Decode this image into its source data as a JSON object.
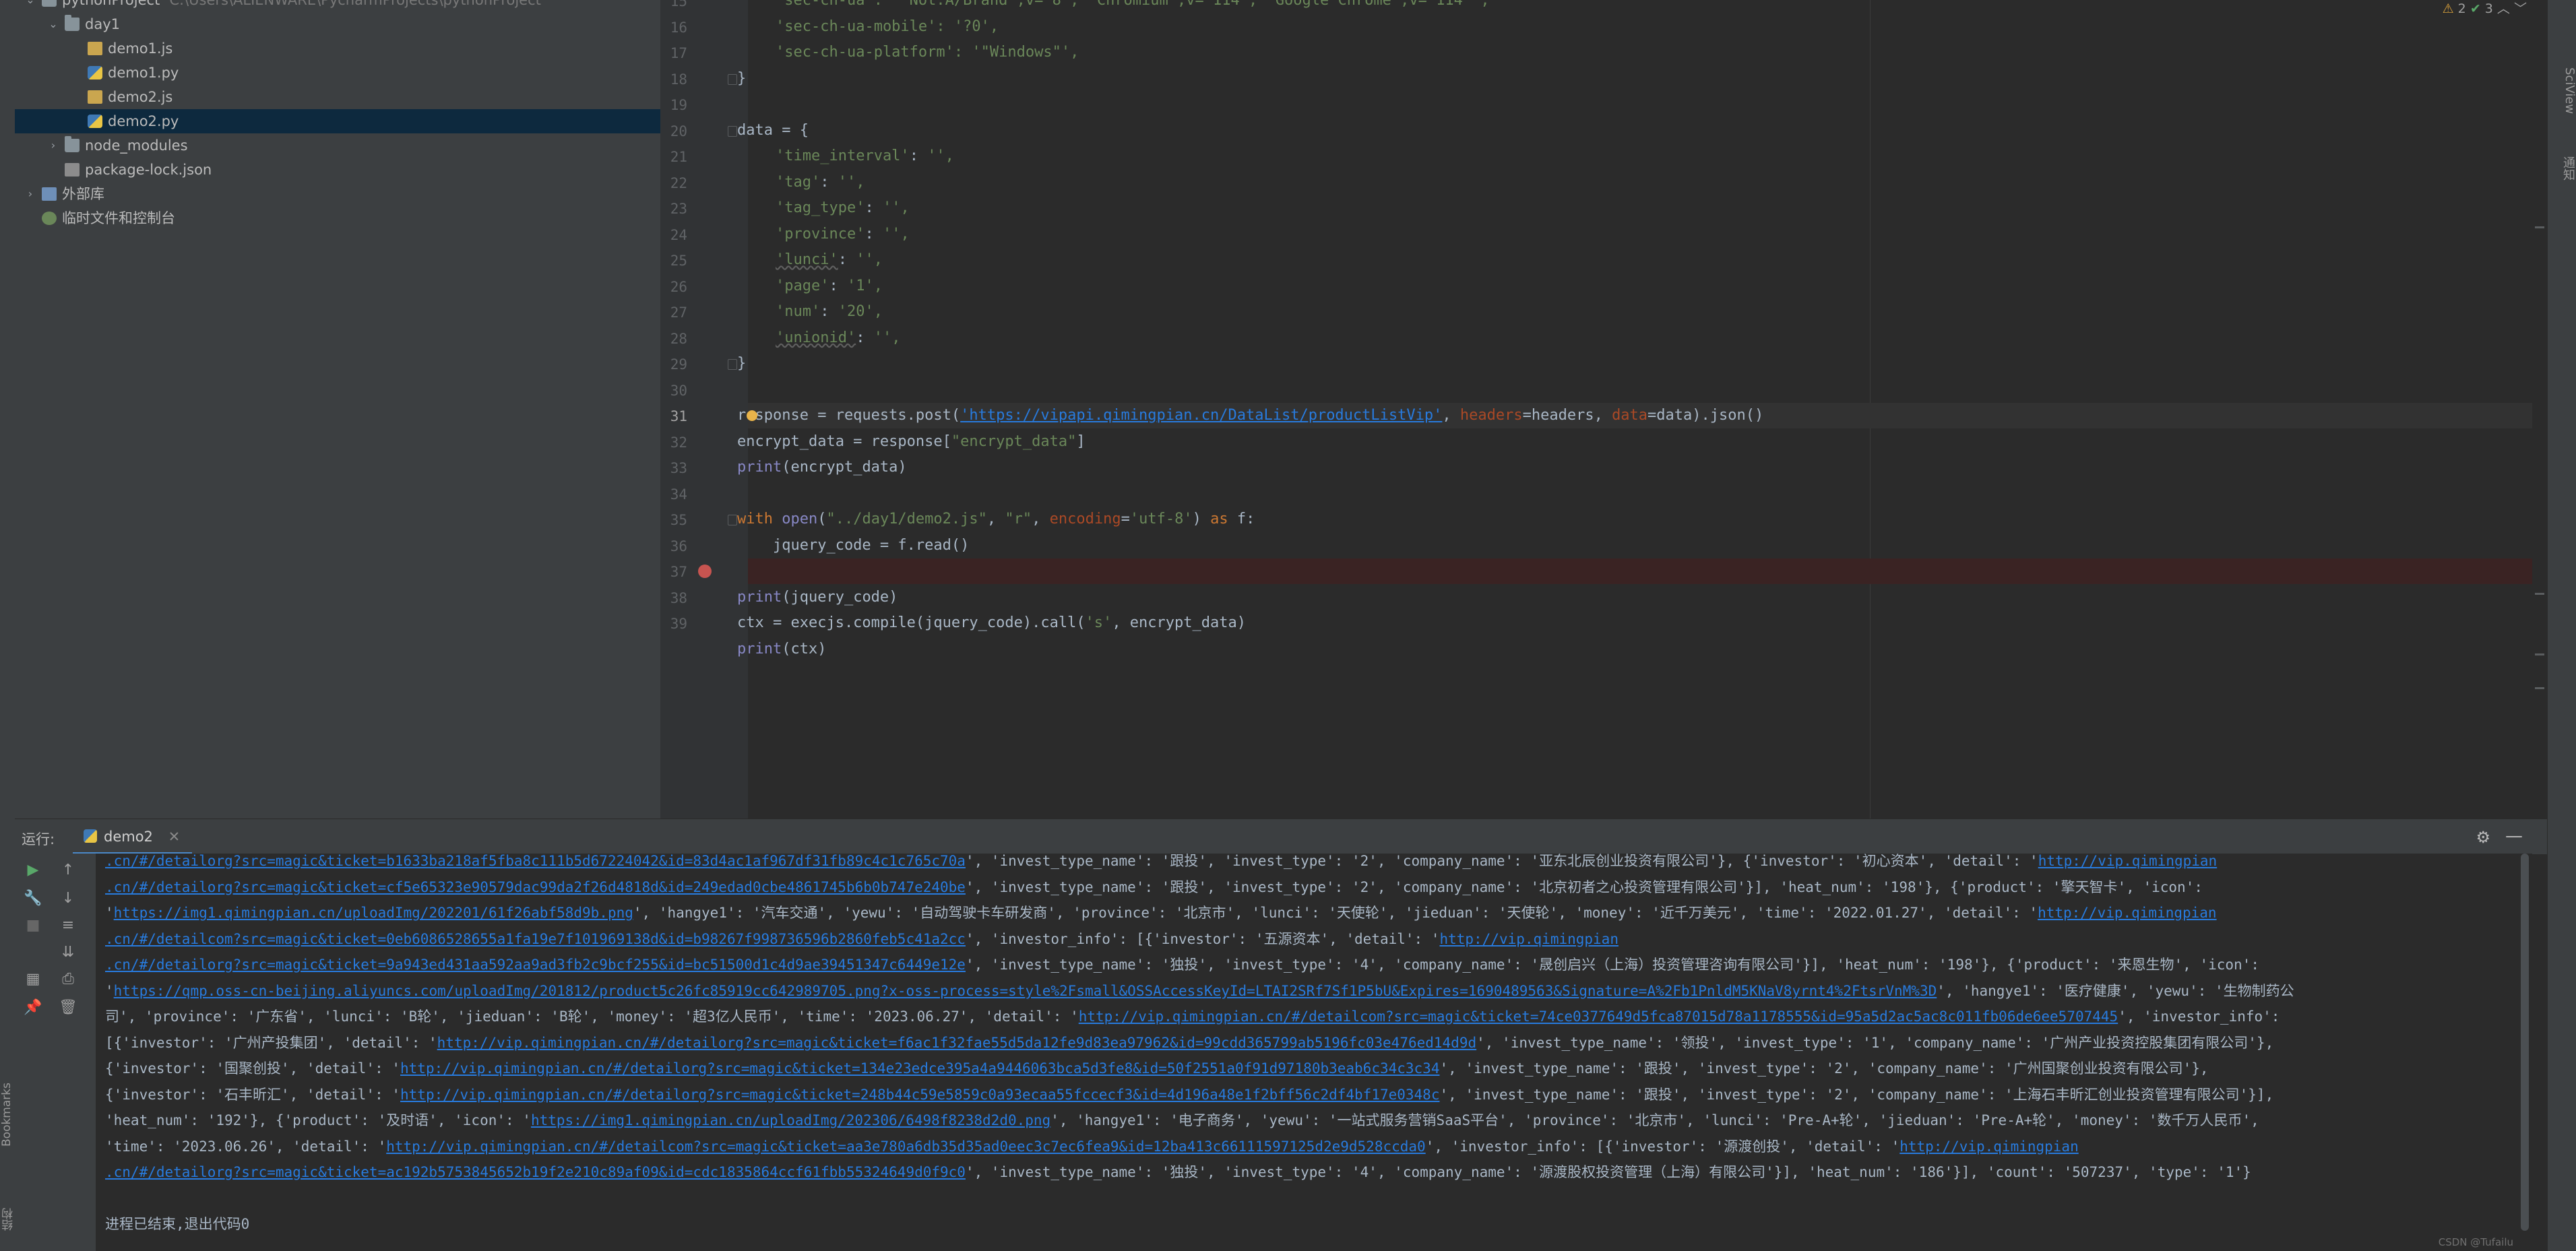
{
  "project_tree": [
    {
      "label": "pythonProject",
      "path": "C:\\Users\\ALIENWARE\\PycharmProjects\\pythonProject",
      "kind": "folder",
      "expanded": true
    },
    {
      "label": "day1",
      "kind": "folder",
      "expanded": true
    },
    {
      "label": "demo1.js",
      "kind": "js"
    },
    {
      "label": "demo1.py",
      "kind": "py"
    },
    {
      "label": "demo2.js",
      "kind": "js"
    },
    {
      "label": "demo2.py",
      "kind": "py",
      "selected": true
    },
    {
      "label": "node_modules",
      "kind": "folder",
      "expanded": false
    },
    {
      "label": "package-lock.json",
      "kind": "json"
    },
    {
      "label": "外部库",
      "kind": "lib",
      "expanded": false
    },
    {
      "label": "临时文件和控制台",
      "kind": "scratch"
    }
  ],
  "editor": {
    "inspection": {
      "warnings": "2",
      "checks": "3"
    },
    "current_line": 31,
    "breakpoint_line": 37,
    "line_numbers": [
      "15",
      "16",
      "17",
      "18",
      "19",
      "20",
      "21",
      "22",
      "23",
      "24",
      "25",
      "26",
      "27",
      "28",
      "29",
      "30",
      "31",
      "32",
      "33",
      "34",
      "35",
      "36",
      "37",
      "38",
      "39"
    ],
    "lines": {
      "l15": "'sec-ch-ua': '\"Not.A/Brand\";v=\"8\", \"Chromium\";v=\"114\", \"Google Chrome\";v=\"114\"',",
      "l16": "'sec-ch-ua-mobile': '?0',",
      "l17": "'sec-ch-ua-platform': '\"Windows\"',",
      "l18": "}",
      "l20": "data = {",
      "l21_key": "'time_interval'",
      "l21_val": "'',",
      "l22_key": "'tag'",
      "l22_val": "'',",
      "l23_key": "'tag_type'",
      "l23_val": "'',",
      "l24_key": "'province'",
      "l24_val": "'',",
      "l25_key": "'lunci'",
      "l25_val": "'',",
      "l26_key": "'page'",
      "l26_val": "'1',",
      "l27_key": "'num'",
      "l27_val": "'20',",
      "l28_key": "'unionid'",
      "l28_val": "'',",
      "l29": "}",
      "l31_a": "response = requests.post(",
      "l31_url": "'https://vipapi.qimingpian.cn/DataList/productListVip'",
      "l31_b": ", ",
      "l31_headers": "headers",
      "l31_c": "=headers, ",
      "l31_data": "data",
      "l31_d": "=data).json()",
      "l32_a": "encrypt_data = response[",
      "l32_s": "\"encrypt_data\"",
      "l32_b": "]",
      "l33_a": "print",
      "l33_b": "(encrypt_data)",
      "l35_with": "with ",
      "l35_open": "open",
      "l35_a": "(",
      "l35_s1": "\"../day1/demo2.js\"",
      "l35_b": ", ",
      "l35_s2": "\"r\"",
      "l35_c": ", ",
      "l35_enc": "encoding",
      "l35_d": "=",
      "l35_s3": "'utf-8'",
      "l35_e": ") ",
      "l35_as": "as",
      "l35_f": " f:",
      "l36": "    jquery_code = f.read()",
      "l38_a": "print",
      "l38_b": "(jquery_code)",
      "l39_a": "ctx = execjs.compile(jquery_code).call(",
      "l39_s": "'s'",
      "l39_b": ", encrypt_data)",
      "l40_a": "print",
      "l40_b": "(ctx)"
    }
  },
  "run_panel": {
    "label": "运行:",
    "tab": "demo2",
    "console": [
      {
        "segs": [
          {
            "t": ".cn/#/detailorg?src=magic&ticket=b1633ba218af5fba8c111b5d67224042&id=83d4ac1af967df31fb89c4c1c765c70a",
            "link": true
          },
          {
            "t": "', 'invest_type_name': '跟投', 'invest_type': '2', 'company_name': '亚东北辰创业投资有限公司'}, {'investor': '初心资本', 'detail': '"
          },
          {
            "t": "http://vip.qimingpian",
            "link": true
          }
        ]
      },
      {
        "segs": [
          {
            "t": ".cn/#/detailorg?src=magic&ticket=cf5e65323e90579dac99da2f26d4818d&id=249edad0cbe4861745b6b0b747e240be",
            "link": true
          },
          {
            "t": "', 'invest_type_name': '跟投', 'invest_type': '2', 'company_name': '北京初者之心投资管理有限公司'}], 'heat_num': '198'}, {'product': '擎天智卡', 'icon':"
          }
        ]
      },
      {
        "segs": [
          {
            "t": "'"
          },
          {
            "t": "https://img1.qimingpian.cn/uploadImg/202201/61f26abf58d9b.png",
            "link": true
          },
          {
            "t": "', 'hangye1': '汽车交通', 'yewu': '自动驾驶卡车研发商', 'province': '北京市', 'lunci': '天使轮', 'jieduan': '天使轮', 'money': '近千万美元', 'time': '2022.01.27', 'detail': '"
          },
          {
            "t": "http://vip.qimingpian",
            "link": true
          }
        ]
      },
      {
        "segs": [
          {
            "t": ".cn/#/detailcom?src=magic&ticket=0eb6086528655a1fa19e7f101969138d&id=b98267f998736596b2860feb5c41a2cc",
            "link": true
          },
          {
            "t": "', 'investor_info': [{'investor': '五源资本', 'detail': '"
          },
          {
            "t": "http://vip.qimingpian",
            "link": true
          }
        ]
      },
      {
        "segs": [
          {
            "t": ".cn/#/detailorg?src=magic&ticket=9a943ed431aa592aa9ad3fb2c9bcf255&id=bc51500d1c4d9ae39451347c6449e12e",
            "link": true
          },
          {
            "t": "', 'invest_type_name': '独投', 'invest_type': '4', 'company_name': '晟创启兴（上海）投资管理咨询有限公司'}], 'heat_num': '198'}, {'product': '来恩生物', 'icon':"
          }
        ]
      },
      {
        "segs": [
          {
            "t": "'"
          },
          {
            "t": "https://qmp.oss-cn-beijing.aliyuncs.com/uploadImg/201812/product5c26fc85919cc642989705.png?x-oss-process=style%2Fsmall&OSSAccessKeyId=LTAI2SRf7Sf1P5bU&Expires=1690489563&Signature=A%2Fb1PnldM5KNaV8yrnt4%2FtsrVnM%3D",
            "link": true
          },
          {
            "t": "', 'hangye1': '医疗健康', 'yewu': '生物制药公"
          }
        ]
      },
      {
        "segs": [
          {
            "t": "司', 'province': '广东省', 'lunci': 'B轮', 'jieduan': 'B轮', 'money': '超3亿人民币', 'time': '2023.06.27', 'detail': '"
          },
          {
            "t": "http://vip.qimingpian.cn/#/detailcom?src=magic&ticket=74ce0377649d5fca87015d78a1178555&id=95a5d2ac5ac8c011fb06de6ee5707445",
            "link": true
          },
          {
            "t": "', 'investor_info':"
          }
        ]
      },
      {
        "segs": [
          {
            "t": "[{'investor': '广州产投集团', 'detail': '"
          },
          {
            "t": "http://vip.qimingpian.cn/#/detailorg?src=magic&ticket=f6ac1f32fae55d5da12fe9d83ea97962&id=99cdd365799ab5196fc03e476ed14d9d",
            "link": true
          },
          {
            "t": "', 'invest_type_name': '领投', 'invest_type': '1', 'company_name': '广州产业投资控股集团有限公司'},"
          }
        ]
      },
      {
        "segs": [
          {
            "t": "{'investor': '国聚创投', 'detail': '"
          },
          {
            "t": "http://vip.qimingpian.cn/#/detailorg?src=magic&ticket=134e23edce395a4a9446063bca5d3fe8&id=50f2551a0f91d97180b3eab6c34c3c34",
            "link": true
          },
          {
            "t": "', 'invest_type_name': '跟投', 'invest_type': '2', 'company_name': '广州国聚创业投资有限公司'},"
          }
        ]
      },
      {
        "segs": [
          {
            "t": "{'investor': '石丰昕汇', 'detail': '"
          },
          {
            "t": "http://vip.qimingpian.cn/#/detailorg?src=magic&ticket=248b44c59e5859c0a93ecaa55fccecf3&id=4d196a48e1f2bff56c2df4bf17e0348c",
            "link": true
          },
          {
            "t": "', 'invest_type_name': '跟投', 'invest_type': '2', 'company_name': '上海石丰昕汇创业投资管理有限公司'}],"
          }
        ]
      },
      {
        "segs": [
          {
            "t": "'heat_num': '192'}, {'product': '及时语', 'icon': '"
          },
          {
            "t": "https://img1.qimingpian.cn/uploadImg/202306/6498f8238d2d0.png",
            "link": true
          },
          {
            "t": "', 'hangye1': '电子商务', 'yewu': '一站式服务营销SaaS平台', 'province': '北京市', 'lunci': 'Pre-A+轮', 'jieduan': 'Pre-A+轮', 'money': '数千万人民币',"
          }
        ]
      },
      {
        "segs": [
          {
            "t": "'time': '2023.06.26', 'detail': '"
          },
          {
            "t": "http://vip.qimingpian.cn/#/detailcom?src=magic&ticket=aa3e780a6db35d35ad0eec3c7ec6fea9&id=12ba413c66111597125d2e9d528ccda0",
            "link": true
          },
          {
            "t": "', 'investor_info': [{'investor': '源渡创投', 'detail': '"
          },
          {
            "t": "http://vip.qimingpian",
            "link": true
          }
        ]
      },
      {
        "segs": [
          {
            "t": ".cn/#/detailorg?src=magic&ticket=ac192b5753845652b19f2e210c89af09&id=cdc1835864ccf61fbb55324649d0f9c0",
            "link": true
          },
          {
            "t": "', 'invest_type_name': '独投', 'invest_type': '4', 'company_name': '源渡股权投资管理（上海）有限公司'}], 'heat_num': '186'}], 'count': '507237', 'type': '1'}"
          }
        ]
      },
      {
        "segs": [
          {
            "t": ""
          }
        ]
      },
      {
        "segs": [
          {
            "t": "进程已结束,退出代码0"
          }
        ]
      }
    ]
  },
  "left_strip_labels": [
    "Bookmarks",
    "结构"
  ],
  "right_strip_labels": [
    "SciView",
    "通知"
  ],
  "watermark": "CSDN @Tufailu"
}
